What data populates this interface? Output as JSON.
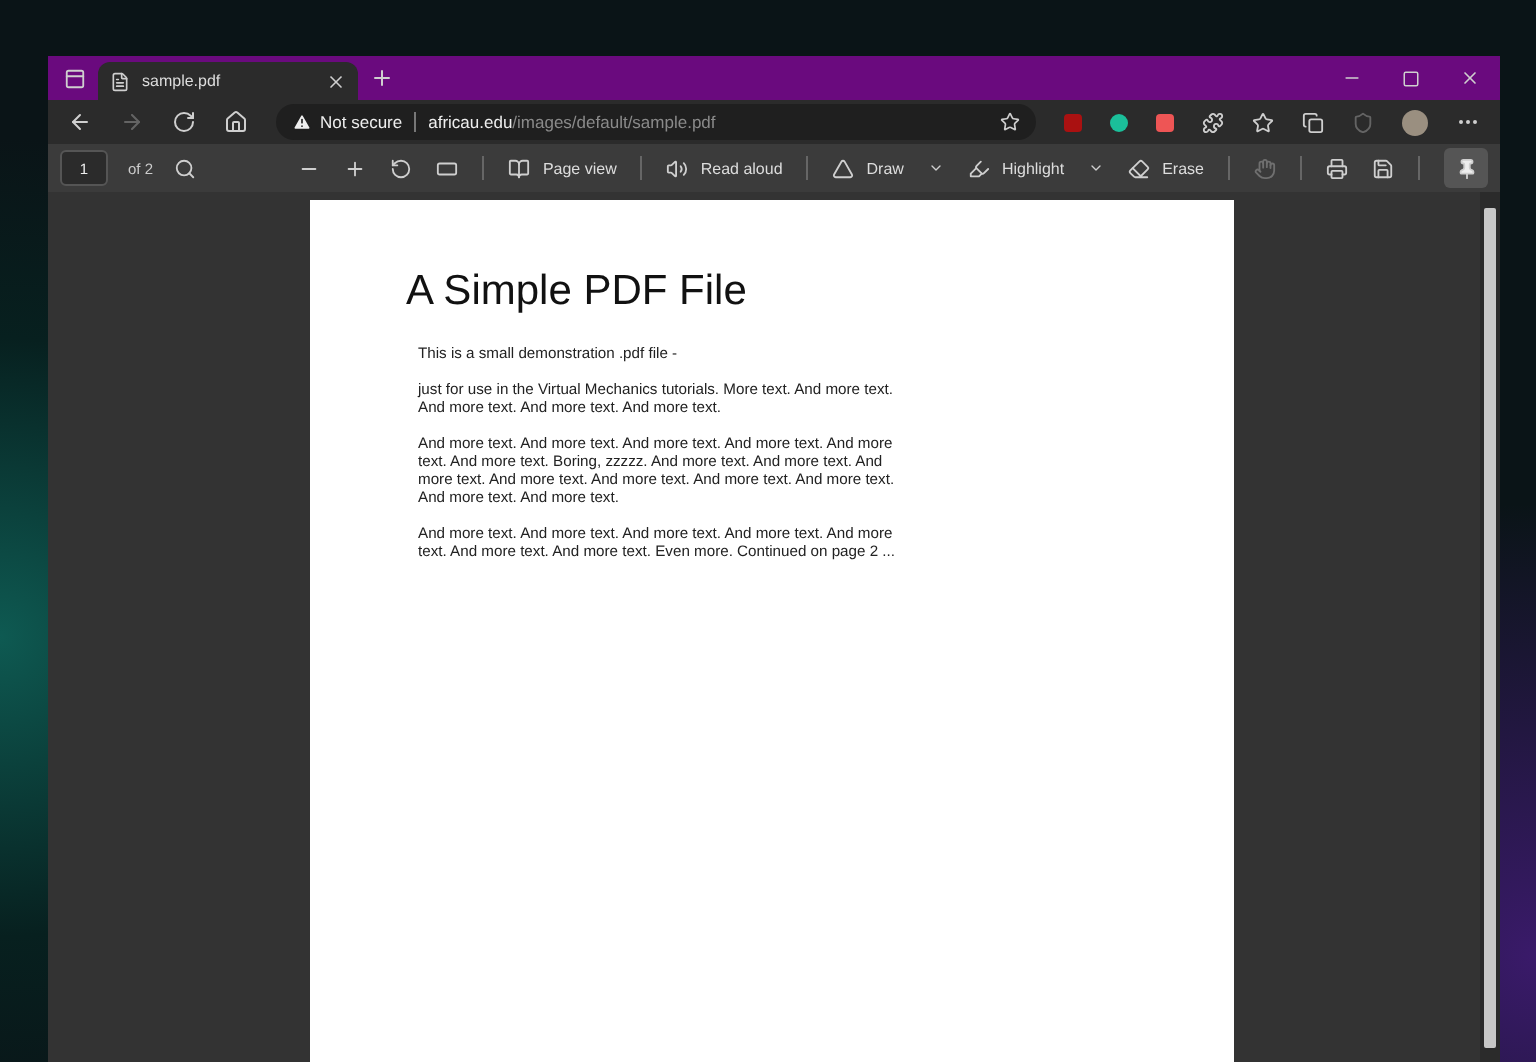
{
  "window": {
    "tabs": [
      {
        "title": "sample.pdf",
        "selected": true
      }
    ]
  },
  "nav": [
    {
      "kind": "back",
      "disabled": false
    },
    {
      "kind": "forward",
      "disabled": true
    },
    {
      "kind": "reload",
      "disabled": false
    },
    {
      "kind": "home",
      "disabled": false
    }
  ],
  "address": {
    "security": "Not secure",
    "host": "africau.edu",
    "path": "/images/default/sample.pdf"
  },
  "pdf_toolbar": {
    "page": "1",
    "page_count": "of 2",
    "pinned": true,
    "tools": [
      {
        "kind": "zoom-out",
        "disabled": false
      },
      {
        "kind": "zoom-in",
        "disabled": false
      },
      {
        "kind": "rotate",
        "disabled": false
      },
      {
        "kind": "fit",
        "disabled": false
      },
      {
        "kind": "sep"
      },
      {
        "kind": "page-view",
        "label": "Page view",
        "disabled": false
      },
      {
        "kind": "sep"
      },
      {
        "kind": "read-aloud",
        "label": "Read aloud",
        "disabled": false
      },
      {
        "kind": "sep"
      },
      {
        "kind": "draw",
        "label": "Draw",
        "disabled": false
      },
      {
        "kind": "caret",
        "disabled": false
      },
      {
        "kind": "highlight",
        "label": "Highlight",
        "disabled": false
      },
      {
        "kind": "caret",
        "disabled": false
      },
      {
        "kind": "erase",
        "label": "Erase",
        "disabled": false
      },
      {
        "kind": "sep"
      },
      {
        "kind": "touch",
        "disabled": true
      },
      {
        "kind": "sep"
      },
      {
        "kind": "print",
        "disabled": false
      },
      {
        "kind": "save",
        "disabled": false
      }
    ]
  },
  "document": {
    "title": "A Simple PDF File",
    "paragraphs": [
      "This is a small demonstration .pdf file -",
      "just for use in the Virtual Mechanics tutorials. More text. And more text. And more text. And more text. And more text.",
      "And more text. And more text. And more text. And more text. And more text. And more text. Boring, zzzzz. And more text. And more text. And more text. And more text. And more text. And more text. And more text. And more text. And more text.",
      "And more text. And more text. And more text. And more text. And more text. And more text. And more text. Even more. Continued on page 2 ..."
    ]
  }
}
